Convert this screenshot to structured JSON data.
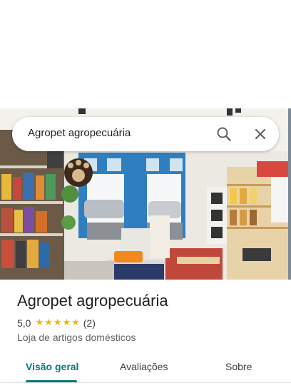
{
  "search": {
    "query": "Agropet agropecuária",
    "search_icon": "search-icon",
    "close_icon": "close-icon"
  },
  "place": {
    "name": "Agropet agropecuária",
    "rating": "5,0",
    "stars": 5,
    "review_count": "(2)",
    "category": "Loja de artigos domésticos",
    "photo_icon": "storefront-photo"
  },
  "tabs": [
    {
      "label": "Visão geral",
      "active": true
    },
    {
      "label": "Avaliações",
      "active": false
    },
    {
      "label": "Sobre",
      "active": false
    }
  ],
  "colors": {
    "accent": "#087a7f",
    "star": "#f5b400",
    "text": "#202124",
    "secondary_text": "#5f6368"
  }
}
